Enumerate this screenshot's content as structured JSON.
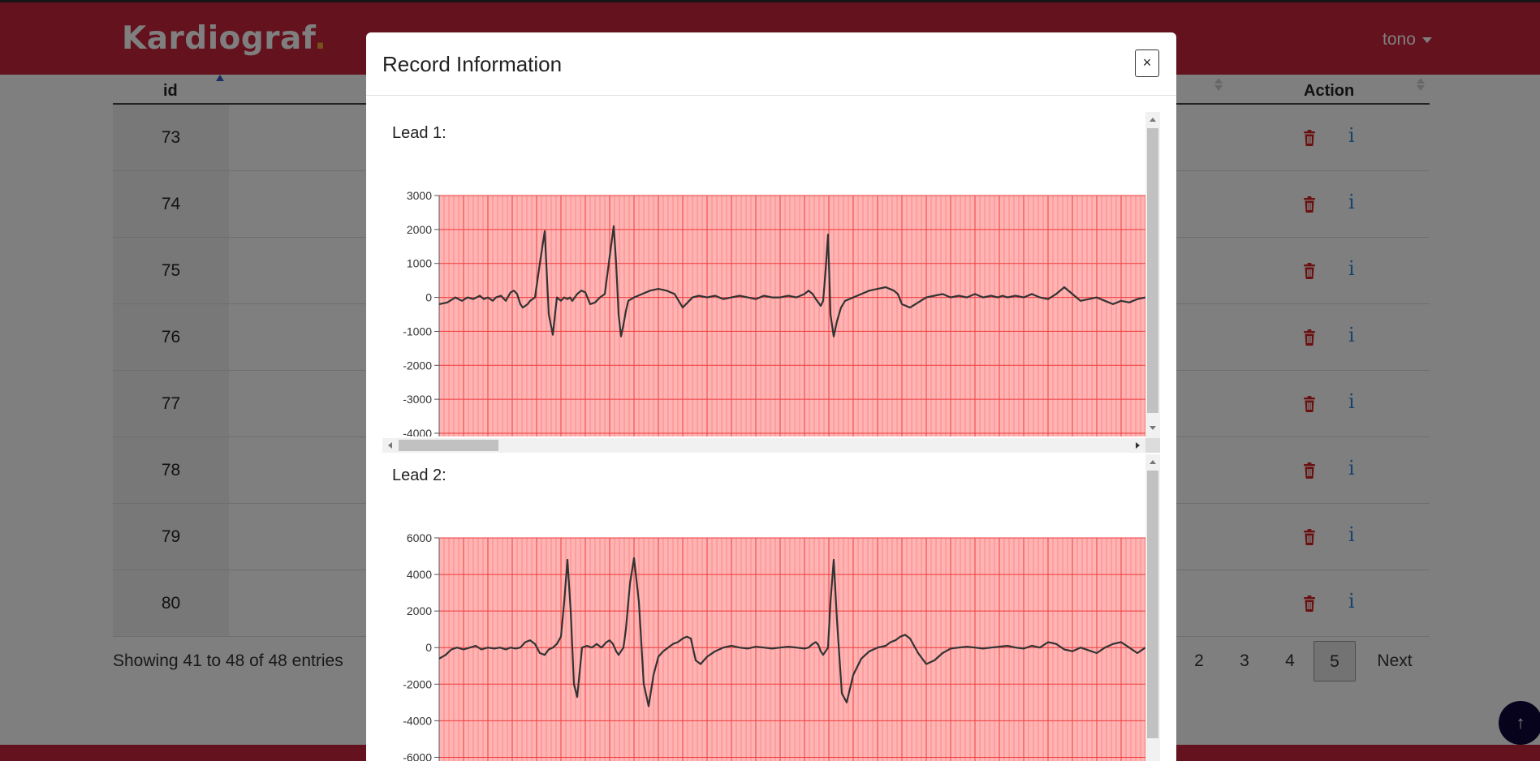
{
  "navbar": {
    "brand": "Kardiograf",
    "brand_dot": ".",
    "user": "tono"
  },
  "table": {
    "headers": {
      "id": "id",
      "action": "Action"
    },
    "rows": [
      {
        "id": "73"
      },
      {
        "id": "74"
      },
      {
        "id": "75"
      },
      {
        "id": "76"
      },
      {
        "id": "77"
      },
      {
        "id": "78"
      },
      {
        "id": "79"
      },
      {
        "id": "80"
      }
    ],
    "info_icon_glyph": "i"
  },
  "footer": {
    "info": "Showing 41 to 48 of 48 entries",
    "pages": [
      "2",
      "3",
      "4",
      "5"
    ],
    "active_page": "5",
    "next": "Next"
  },
  "back_to_top_glyph": "↑",
  "modal": {
    "title": "Record Information",
    "close": "×"
  },
  "colors": {
    "navbar": "#c8243b",
    "brand_dot": "#f2a23c",
    "grid_bg": "#ffb3b3",
    "grid_major": "#ef3c3c",
    "grid_minor": "#f27070",
    "trace": "#333333",
    "info_icon": "#2f86d6",
    "trash_icon": "#d42020"
  },
  "chart_data": [
    {
      "type": "line",
      "title": "Lead 1:",
      "yticks": [
        "3000",
        "2000",
        "1000",
        "0",
        "-1000",
        "-2000",
        "-3000",
        "-4000"
      ],
      "ylim": [
        -4000,
        3000
      ],
      "grid": true,
      "x": [
        0,
        10,
        20,
        28,
        35,
        42,
        50,
        55,
        60,
        63,
        66,
        70,
        76,
        82,
        88,
        92,
        96,
        100,
        103,
        106,
        109,
        112,
        118,
        124,
        130,
        135,
        140,
        145,
        150,
        154,
        158,
        161,
        164,
        167,
        170,
        175,
        180,
        186,
        192,
        198,
        204,
        210,
        215,
        218,
        221,
        224,
        227,
        230,
        233,
        240,
        250,
        260,
        270,
        280,
        290,
        300,
        304,
        308,
        312,
        320,
        330,
        340,
        350,
        360,
        370,
        380,
        390,
        400,
        410,
        420,
        430,
        440,
        450,
        455,
        460,
        464,
        467,
        470,
        473,
        476,
        479,
        482,
        486,
        490,
        495,
        500,
        510,
        520,
        530,
        540,
        550,
        560,
        565,
        570,
        580,
        590,
        600,
        610,
        620,
        630,
        640,
        650,
        660,
        670,
        680,
        688,
        694,
        700,
        710,
        720,
        730,
        740,
        750,
        760,
        770,
        780,
        790,
        800,
        810,
        820,
        830,
        840,
        850,
        860,
        870
      ],
      "y": [
        -200,
        -150,
        0,
        -100,
        0,
        -50,
        50,
        -50,
        0,
        -50,
        -100,
        0,
        50,
        -100,
        150,
        200,
        100,
        -200,
        -300,
        -250,
        -200,
        -100,
        0,
        1000,
        1950,
        -500,
        -1100,
        0,
        -100,
        0,
        -50,
        0,
        -100,
        0,
        100,
        200,
        150,
        -200,
        -150,
        0,
        100,
        1200,
        2100,
        1000,
        -500,
        -1150,
        -800,
        -400,
        -100,
        0,
        100,
        200,
        250,
        200,
        100,
        -300,
        -200,
        -100,
        0,
        50,
        0,
        50,
        -50,
        0,
        50,
        0,
        -50,
        50,
        0,
        0,
        50,
        0,
        100,
        200,
        100,
        -50,
        -150,
        -250,
        -100,
        800,
        1850,
        -500,
        -1150,
        -700,
        -300,
        -100,
        0,
        100,
        200,
        250,
        300,
        200,
        100,
        -200,
        -300,
        -150,
        0,
        50,
        100,
        0,
        50,
        0,
        100,
        0,
        50,
        0,
        50,
        0,
        50,
        0,
        100,
        0,
        -50,
        100,
        300,
        100,
        -100,
        -50,
        0,
        -100,
        -200,
        -100,
        -150,
        -50,
        0
      ]
    },
    {
      "type": "line",
      "title": "Lead 2:",
      "yticks": [
        "6000",
        "4000",
        "2000",
        "0",
        "-2000",
        "-4000",
        "-6000"
      ],
      "ylim": [
        -7000,
        6000
      ],
      "grid": true,
      "x": [
        0,
        8,
        15,
        22,
        30,
        38,
        45,
        52,
        60,
        68,
        75,
        82,
        88,
        94,
        100,
        106,
        112,
        118,
        124,
        130,
        135,
        140,
        145,
        150,
        154,
        158,
        162,
        166,
        170,
        176,
        182,
        188,
        194,
        200,
        206,
        210,
        214,
        218,
        221,
        224,
        227,
        230,
        235,
        240,
        246,
        252,
        258,
        264,
        270,
        276,
        282,
        288,
        294,
        300,
        305,
        310,
        316,
        322,
        330,
        340,
        350,
        360,
        370,
        380,
        390,
        400,
        410,
        420,
        430,
        440,
        450,
        455,
        460,
        464,
        467,
        470,
        473,
        476,
        479,
        482,
        486,
        490,
        496,
        502,
        510,
        520,
        530,
        540,
        550,
        556,
        562,
        568,
        574,
        580,
        590,
        600,
        610,
        620,
        630,
        640,
        650,
        660,
        670,
        680,
        690,
        700,
        710,
        720,
        730,
        740,
        750,
        760,
        770,
        780,
        790,
        800,
        810,
        820,
        830,
        840,
        850,
        860,
        870
      ],
      "y": [
        -600,
        -400,
        -100,
        0,
        -100,
        0,
        100,
        -100,
        0,
        -50,
        0,
        -100,
        0,
        -50,
        0,
        300,
        400,
        200,
        -300,
        -400,
        -100,
        0,
        200,
        600,
        2500,
        4800,
        2000,
        -2000,
        -2700,
        0,
        100,
        0,
        200,
        0,
        300,
        400,
        200,
        -200,
        -400,
        -200,
        0,
        1000,
        3500,
        4900,
        2500,
        -2000,
        -3200,
        -1500,
        -500,
        -200,
        0,
        200,
        300,
        500,
        600,
        500,
        -700,
        -900,
        -500,
        -200,
        0,
        100,
        0,
        -50,
        50,
        0,
        -50,
        0,
        50,
        0,
        -50,
        0,
        200,
        300,
        150,
        -200,
        -400,
        -200,
        0,
        2500,
        4800,
        1500,
        -2500,
        -3000,
        -1500,
        -600,
        -200,
        0,
        100,
        300,
        400,
        600,
        700,
        500,
        -300,
        -900,
        -700,
        -300,
        -50,
        0,
        50,
        0,
        -50,
        0,
        50,
        100,
        0,
        -50,
        100,
        0,
        300,
        200,
        -100,
        -200,
        0,
        -150,
        -300,
        0,
        200,
        300,
        0,
        -300,
        0
      ]
    }
  ]
}
